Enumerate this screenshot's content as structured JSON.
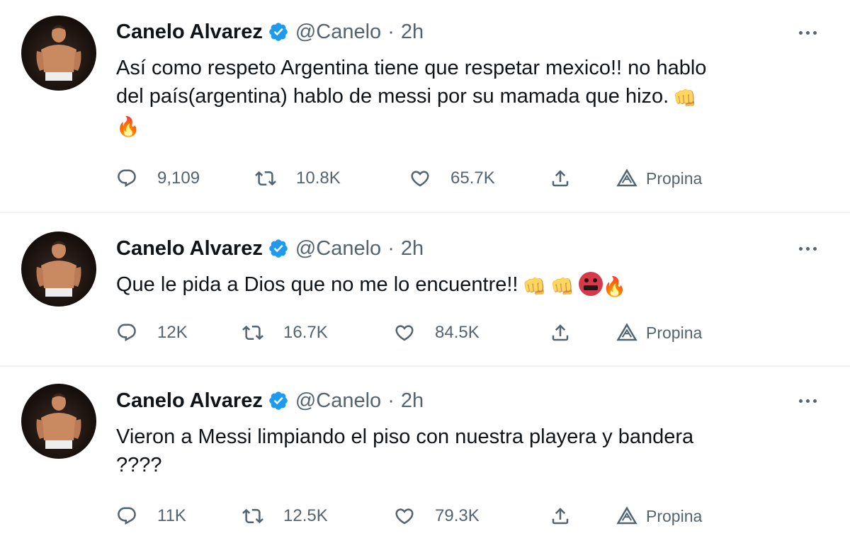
{
  "colors": {
    "text": "#0f1419",
    "secondary": "#536471",
    "verified": "#1d9bf0",
    "divider": "#eff3f4"
  },
  "icons": {
    "more": "more-horizontal-icon",
    "reply": "reply-bubble-icon",
    "retweet": "retweet-icon",
    "like": "heart-icon",
    "share": "share-upload-icon",
    "tip": "tip-triangle-icon",
    "verified": "verified-badge-icon"
  },
  "tweets": [
    {
      "author": {
        "name": "Canelo Alvarez",
        "handle": "@Canelo",
        "separator": "·",
        "time": "2h"
      },
      "text_line1": "Así como respeto Argentina tiene que respetar mexico!! no hablo",
      "text_line2": "del país(argentina) hablo de messi por su mamada que hizo.",
      "emojis": [
        "👊",
        "🔥"
      ],
      "stats": {
        "replies": "9,109",
        "retweets": "10.8K",
        "likes": "65.7K",
        "tip_label": "Propina"
      }
    },
    {
      "author": {
        "name": "Canelo Alvarez",
        "handle": "@Canelo",
        "separator": "·",
        "time": "2h"
      },
      "text_line1": "Que le pida a Dios que no me lo encuentre!!",
      "emojis": [
        "👊",
        "👊",
        "🤬",
        "🔥"
      ],
      "stats": {
        "replies": "12K",
        "retweets": "16.7K",
        "likes": "84.5K",
        "tip_label": "Propina"
      }
    },
    {
      "author": {
        "name": "Canelo Alvarez",
        "handle": "@Canelo",
        "separator": "·",
        "time": "2h"
      },
      "text_line1": "Vieron a Messi limpiando el piso con nuestra playera y bandera",
      "text_line2": "????",
      "stats": {
        "replies": "11K",
        "retweets": "12.5K",
        "likes": "79.3K",
        "tip_label": "Propina"
      }
    }
  ]
}
